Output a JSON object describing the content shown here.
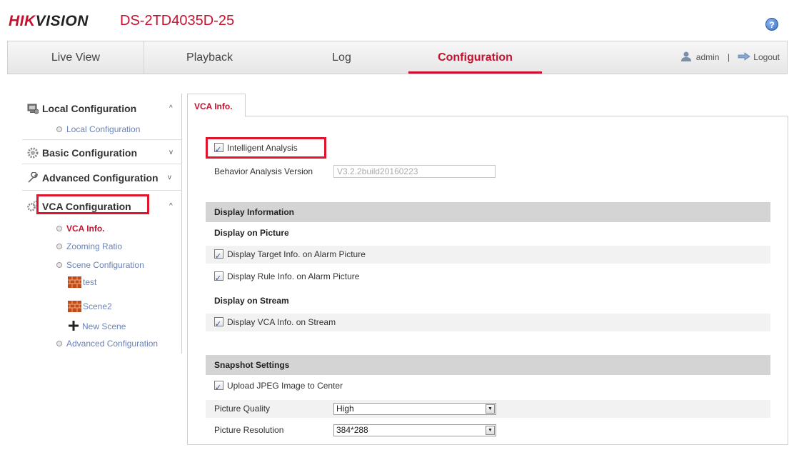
{
  "header": {
    "brand_hik": "HIK",
    "brand_vision": "VISION",
    "model": "DS-2TD4035D-25",
    "help_symbol": "?"
  },
  "topnav": {
    "tabs": [
      {
        "label": "Live View"
      },
      {
        "label": "Playback"
      },
      {
        "label": "Log"
      },
      {
        "label": "Configuration"
      }
    ],
    "active_tab": "Configuration",
    "user": "admin",
    "separator": "|",
    "logout": "Logout"
  },
  "sidebar": {
    "local": {
      "label": "Local Configuration",
      "chevron": "^",
      "items": [
        {
          "label": "Local Configuration"
        }
      ]
    },
    "basic": {
      "label": "Basic Configuration",
      "chevron": "v"
    },
    "advanced": {
      "label": "Advanced Configuration",
      "chevron": "v"
    },
    "vca": {
      "label": "VCA Configuration",
      "chevron": "^",
      "items": [
        {
          "label": "VCA Info."
        },
        {
          "label": "Zooming Ratio"
        },
        {
          "label": "Scene Configuration"
        },
        {
          "label": "Advanced Configuration"
        }
      ],
      "scenes": [
        {
          "label": "test"
        },
        {
          "label": "Scene2"
        }
      ],
      "new_scene": "New Scene"
    }
  },
  "content": {
    "tab": "VCA Info.",
    "intelligent_analysis": {
      "label": "Intelligent Analysis",
      "checked": true
    },
    "behavior_version": {
      "label": "Behavior Analysis Version",
      "value": "V3.2.2build20160223"
    },
    "display_info": {
      "heading": "Display Information",
      "on_picture": "Display on Picture",
      "target_info": {
        "label": "Display Target Info. on Alarm Picture",
        "checked": true
      },
      "rule_info": {
        "label": "Display Rule Info. on Alarm Picture",
        "checked": true
      },
      "on_stream": "Display on Stream",
      "vca_stream": {
        "label": "Display VCA Info. on Stream",
        "checked": true
      }
    },
    "snapshot": {
      "heading": "Snapshot Settings",
      "upload": {
        "label": "Upload JPEG Image to Center",
        "checked": true
      },
      "quality": {
        "label": "Picture Quality",
        "value": "High"
      },
      "resolution": {
        "label": "Picture Resolution",
        "value": "384*288"
      }
    },
    "check_glyph": "✓",
    "dropdown_glyph": "▼"
  },
  "colors": {
    "brand_red": "#c8102e",
    "link_blue": "#6a82b8",
    "highlight_box": "#e0142a"
  }
}
